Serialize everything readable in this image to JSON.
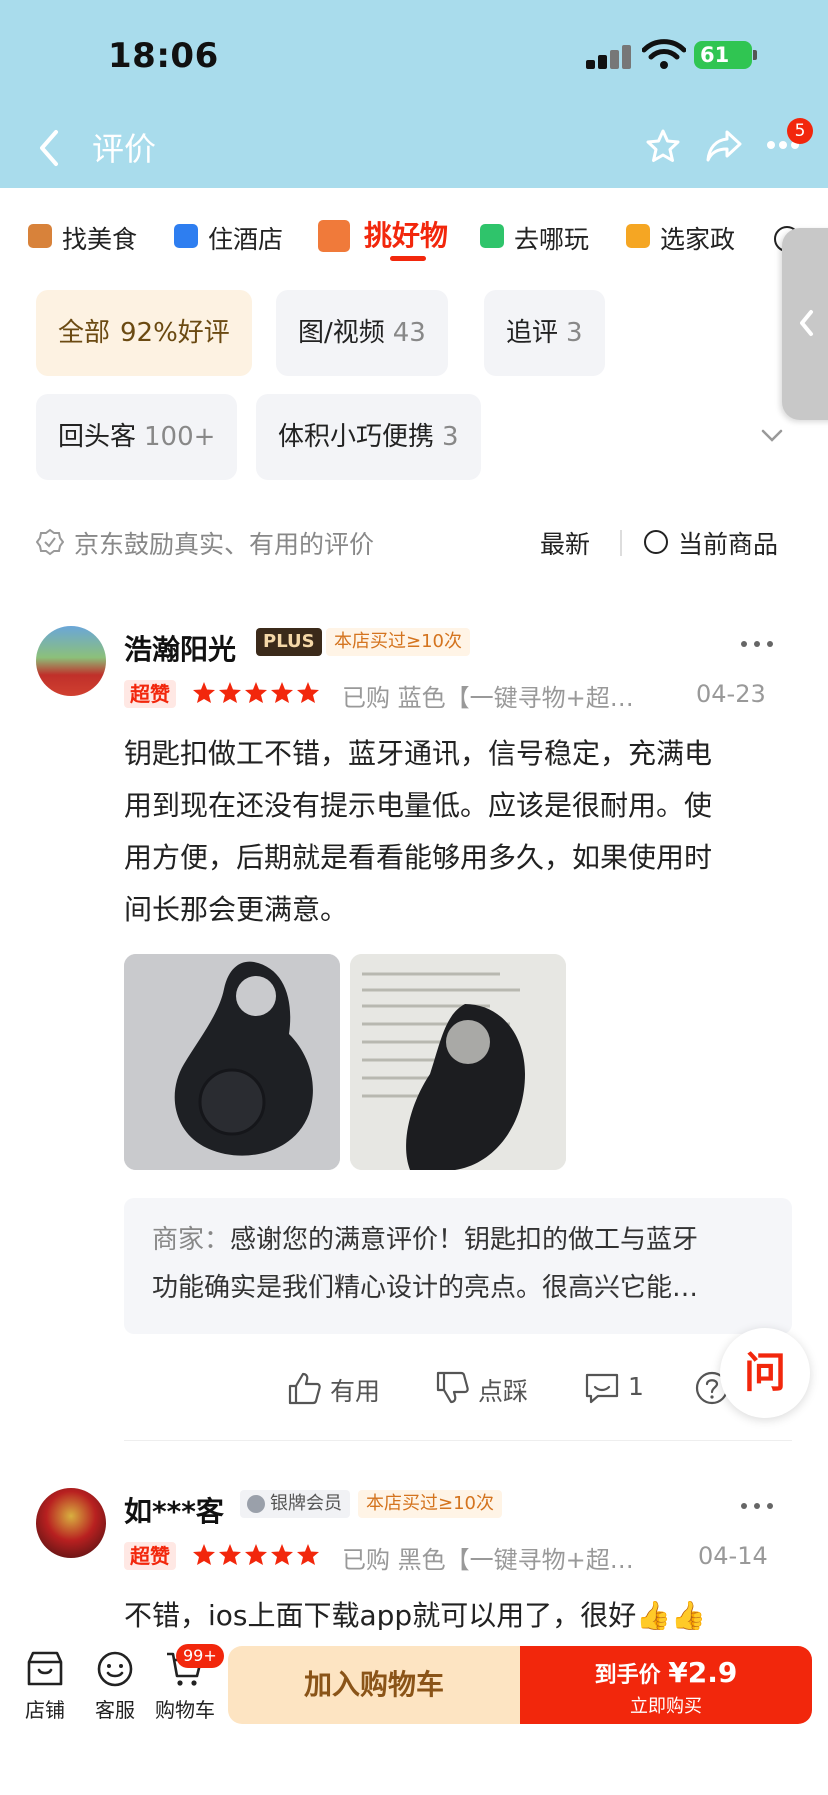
{
  "status_bar": {
    "time": "18:06",
    "battery": "61"
  },
  "header": {
    "title": "评价",
    "more_badge": "5"
  },
  "category_tabs": [
    {
      "label": "找美食",
      "color": "#d8823a"
    },
    {
      "label": "住酒店",
      "color": "#2e7ef0"
    },
    {
      "label": "挑好物",
      "color": "#f07a3a",
      "active": true
    },
    {
      "label": "去哪玩",
      "color": "#2fc46b"
    },
    {
      "label": "选家政",
      "color": "#f5a623"
    }
  ],
  "filters": [
    {
      "label": "全部",
      "count": "92%好评",
      "active": true
    },
    {
      "label": "图/视频",
      "count": "43"
    },
    {
      "label": "追评",
      "count": "3"
    },
    {
      "label": "回头客",
      "count": "100+"
    },
    {
      "label": "体积小巧便携",
      "count": "3"
    }
  ],
  "info_row": {
    "encourage": "京东鼓励真实、有用的评价",
    "sort": "最新",
    "current_product": "当前商品"
  },
  "reviews": [
    {
      "user": "浩瀚阳光",
      "member_badge": "PLUS",
      "store_badge": "本店买过≥10次",
      "rating_badge": "超赞",
      "stars": 5,
      "purchased": "已购 蓝色【一键寻物+超长待机】",
      "date": "04-23",
      "lines": [
        "钥匙扣做工不错，蓝牙通讯，信号稳定，充满电",
        "用到现在还没有提示电量低。应该是很耐用。使",
        "用方便，后期就是看看能够用多久，如果使用时",
        "间长那会更满意。"
      ],
      "merchant_label": "商家：",
      "merchant_reply_line1": "感谢您的满意评价！钥匙扣的做工与蓝牙",
      "merchant_reply_line2": "功能确实是我们精心设计的亮点。很高兴它能…",
      "actions": {
        "useful": "有用",
        "dislike": "点踩",
        "comments": "1"
      }
    },
    {
      "user": "如***客",
      "member_badge": "银牌会员",
      "store_badge": "本店买过≥10次",
      "rating_badge": "超赞",
      "stars": 5,
      "purchased": "已购 黑色【一键寻物+超长待机】",
      "date": "04-14",
      "lines": [
        "不错，ios上面下载app就可以用了，很好👍👍"
      ]
    }
  ],
  "ask_button": "问",
  "bottom_bar": {
    "shop": "店铺",
    "service": "客服",
    "cart": "购物车",
    "cart_badge": "99+",
    "add_to_cart": "加入购物车",
    "final_price_label": "到手价",
    "price": "¥2.9",
    "buy_now": "立即购买"
  },
  "colors": {
    "header_bg": "#a9dcec",
    "accent": "#f2270c",
    "star": "#f2270c"
  }
}
